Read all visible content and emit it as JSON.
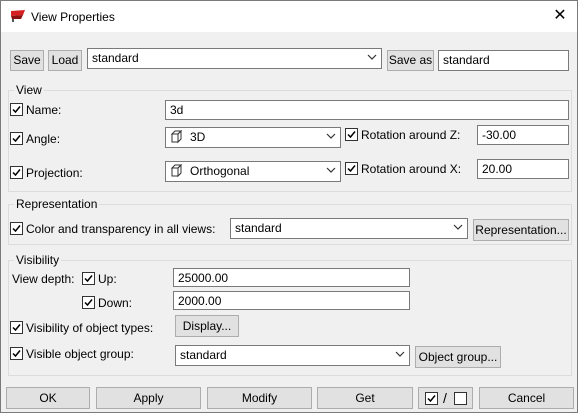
{
  "window": {
    "title": "View Properties",
    "close_glyph": "✕"
  },
  "toolbar": {
    "save_label": "Save",
    "load_label": "Load",
    "config_value": "standard",
    "save_as_label": "Save as",
    "save_as_value": "standard"
  },
  "view": {
    "legend": "View",
    "name_label": "Name:",
    "name_value": "3d",
    "angle_label": "Angle:",
    "angle_value": "3D",
    "rotation_z_label": "Rotation around Z:",
    "rotation_z_value": "-30.00",
    "projection_label": "Projection:",
    "projection_value": "Orthogonal",
    "rotation_x_label": "Rotation around X:",
    "rotation_x_value": "20.00"
  },
  "representation": {
    "legend": "Representation",
    "color_label": "Color and transparency in all views:",
    "color_value": "standard",
    "button_label": "Representation..."
  },
  "visibility": {
    "legend": "Visibility",
    "view_depth_label": "View depth:",
    "up_label": "Up:",
    "up_value": "25000.00",
    "down_label": "Down:",
    "down_value": "2000.00",
    "object_types_label": "Visibility of object types:",
    "display_label": "Display...",
    "object_group_label": "Visible object group:",
    "object_group_value": "standard",
    "object_group_button": "Object group..."
  },
  "footer": {
    "ok_label": "OK",
    "apply_label": "Apply",
    "modify_label": "Modify",
    "get_label": "Get",
    "slash_label": "/",
    "cancel_label": "Cancel"
  },
  "icons": {
    "app": "app-icon",
    "checkbox": "checkmark-icon",
    "cube": "cube-icon",
    "dropdown": "chevron-down-icon"
  }
}
